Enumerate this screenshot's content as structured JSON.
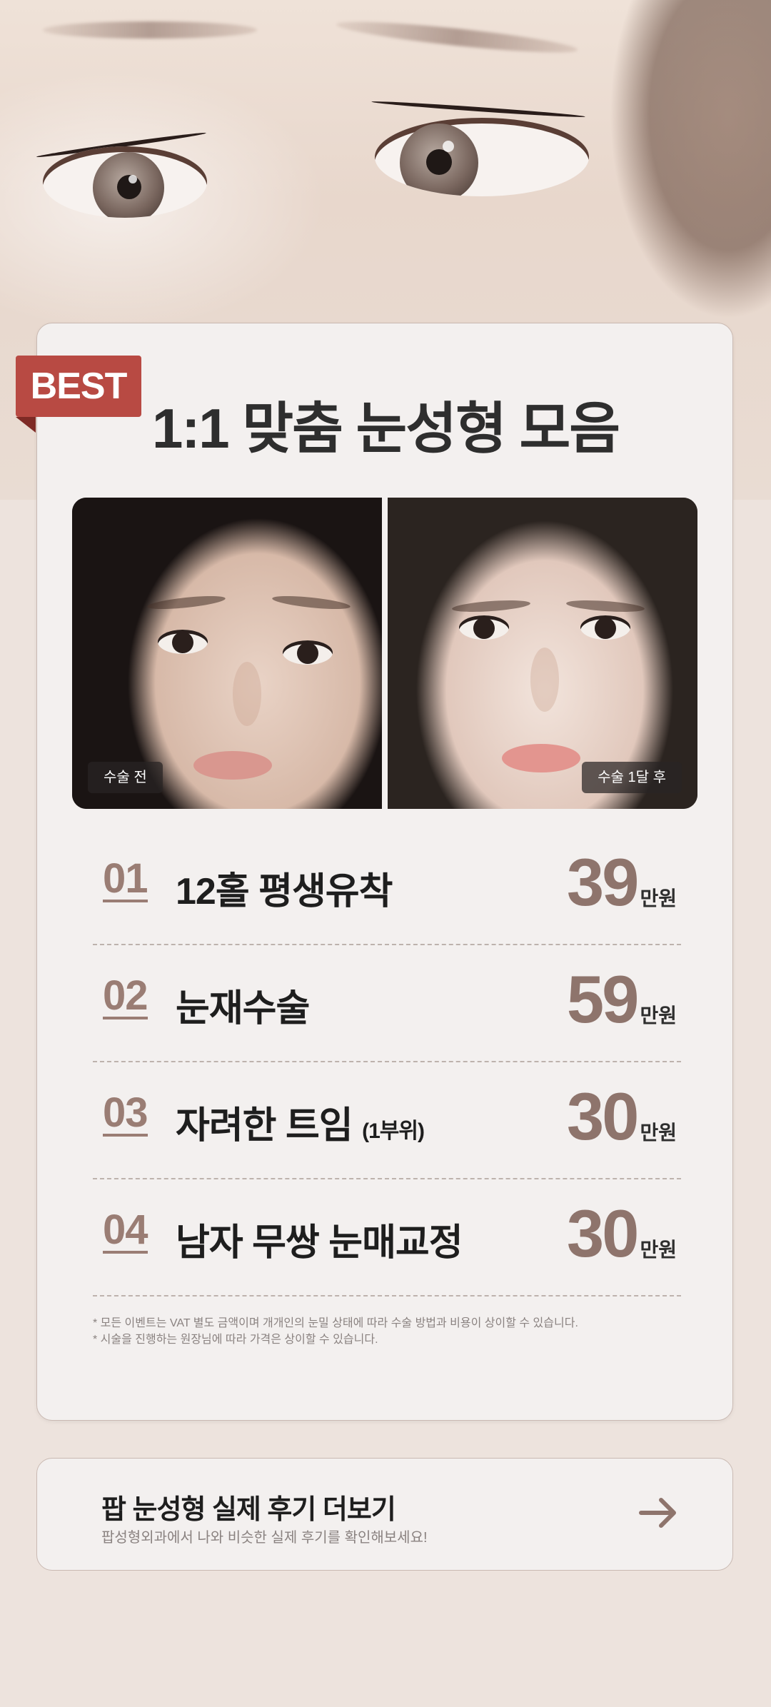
{
  "card": {
    "badge": "BEST",
    "title": "1:1 맞춤 눈성형 모음",
    "before_label": "수술 전",
    "after_label": "수술 1달 후"
  },
  "menu": [
    {
      "no": "01",
      "name": "12홀 평생유착",
      "sub": "",
      "price": "39",
      "unit": "만원"
    },
    {
      "no": "02",
      "name": "눈재수술",
      "sub": "",
      "price": "59",
      "unit": "만원"
    },
    {
      "no": "03",
      "name": "자려한 트임",
      "sub": "(1부위)",
      "price": "30",
      "unit": "만원"
    },
    {
      "no": "04",
      "name": "남자 무쌍 눈매교정",
      "sub": "",
      "price": "30",
      "unit": "만원"
    }
  ],
  "notes": [
    "* 모든 이벤트는 VAT 별도 금액이며 개개인의 눈밀 상태에 따라 수술 방법과 비용이 상이할 수 있습니다.",
    "* 시술을 진행하는 원장님에 따라 가격은 상이할 수 있습니다."
  ],
  "review": {
    "title": "팝 눈성형 실제 후기 더보기",
    "subtitle": "팝성형외과에서 나와 비슷한 실제 후기를 확인해보세요!",
    "arrow_icon": "arrow-right-icon"
  },
  "colors": {
    "accent": "#8e746c",
    "badge": "#b84a43",
    "background": "#ede3dd"
  }
}
